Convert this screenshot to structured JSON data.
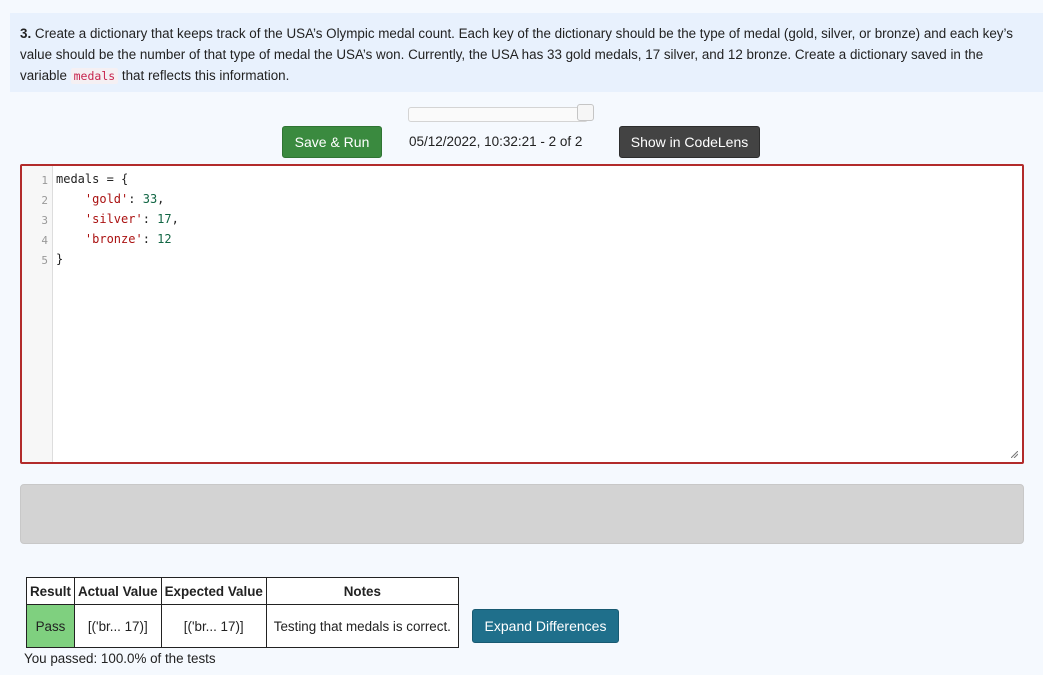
{
  "prompt": {
    "number": "3.",
    "text_before": " Create a dictionary that keeps track of the USA’s Olympic medal count. Each key of the dictionary should be the type of medal (gold, silver, or bronze) and each key’s value should be the number of that type of medal the USA’s won. Currently, the USA has 33 gold medals, 17 silver, and 12 bronze. Create a dictionary saved in the variable ",
    "code_term": "medals",
    "text_after": " that reflects this information."
  },
  "toolbar": {
    "run_label": "Save & Run",
    "timestamp": "05/12/2022, 10:32:21 - 2 of 2",
    "codelens_label": "Show in CodeLens"
  },
  "editor": {
    "line_numbers": [
      "1",
      "2",
      "3",
      "4",
      "5"
    ],
    "lines": [
      {
        "indent": "",
        "parts": [
          {
            "t": "plain",
            "v": "medals = {"
          }
        ]
      },
      {
        "indent": "    ",
        "parts": [
          {
            "t": "str",
            "v": "'gold'"
          },
          {
            "t": "plain",
            "v": ": "
          },
          {
            "t": "num",
            "v": "33"
          },
          {
            "t": "plain",
            "v": ","
          }
        ]
      },
      {
        "indent": "    ",
        "parts": [
          {
            "t": "str",
            "v": "'silver'"
          },
          {
            "t": "plain",
            "v": ": "
          },
          {
            "t": "num",
            "v": "17"
          },
          {
            "t": "plain",
            "v": ","
          }
        ]
      },
      {
        "indent": "    ",
        "parts": [
          {
            "t": "str",
            "v": "'bronze'"
          },
          {
            "t": "plain",
            "v": ": "
          },
          {
            "t": "num",
            "v": "12"
          }
        ]
      },
      {
        "indent": "",
        "parts": [
          {
            "t": "plain",
            "v": "}"
          }
        ]
      }
    ]
  },
  "results": {
    "headers": [
      "Result",
      "Actual Value",
      "Expected Value",
      "Notes"
    ],
    "row": {
      "result": "Pass",
      "actual": "[('br... 17)]",
      "expected": "[('br... 17)]",
      "notes": "Testing that medals is correct."
    },
    "expand_label": "Expand Differences",
    "summary": "You passed: 100.0% of the tests"
  },
  "colors": {
    "run_button": "#3a8a3f",
    "codelens_button": "#434343",
    "expand_button": "#1f6f8b",
    "pass_cell": "#7fd07f",
    "editor_border": "#b22b2b"
  }
}
